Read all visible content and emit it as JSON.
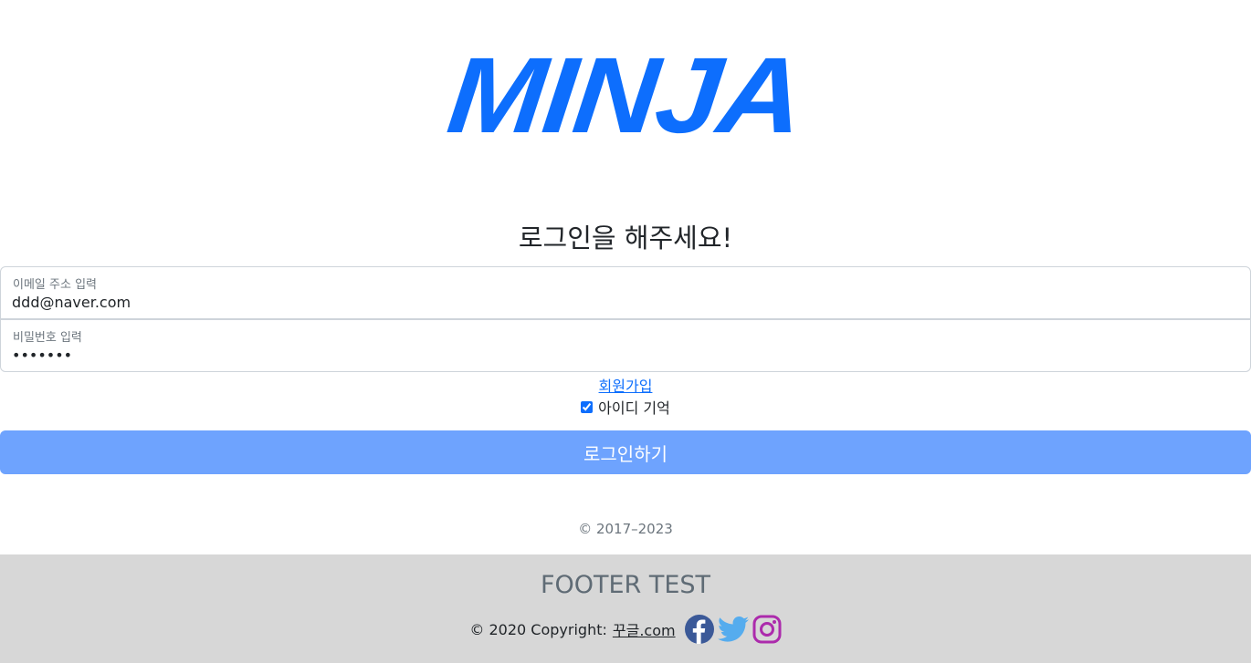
{
  "logo": {
    "text": "MINJA",
    "color": "#0d6efd"
  },
  "heading": "로그인을 해주세요!",
  "form": {
    "email": {
      "label": "이메일 주소 입력",
      "value": "ddd@naver.com"
    },
    "password": {
      "label": "비밀번호 입력",
      "value": "1234567"
    },
    "signup_link": "회원가입",
    "remember_label": "아이디 기억",
    "remember_checked": true,
    "submit_label": "로그인하기"
  },
  "main_copyright": "© 2017–2023",
  "footer": {
    "title": "FOOTER TEST",
    "copyright_prefix": "© 2020 Copyright:",
    "site_link": "꾸글.com",
    "social_icons": [
      "facebook-icon",
      "twitter-icon",
      "instagram-icon"
    ],
    "colors": {
      "facebook": "#3b5998",
      "twitter": "#55acee",
      "instagram": "#ac2bac",
      "background": "#d7d7d7"
    }
  },
  "colors": {
    "accent": "#0d6efd",
    "button": "#6ea3fe"
  }
}
